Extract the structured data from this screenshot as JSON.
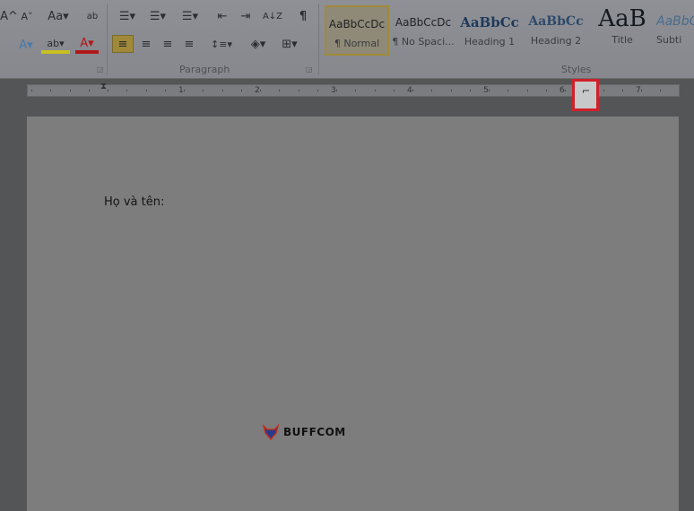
{
  "ribbon": {
    "font_buttons": [
      "A^",
      "A˅",
      "Aa▾",
      "ab"
    ],
    "font_row2": [
      "A▾",
      "ab▾",
      "A▾"
    ],
    "paragraph_row1": [
      "☰▾",
      "☰▾",
      "☰▾",
      "⇤",
      "⇥",
      "A↓Z",
      "¶"
    ],
    "paragraph_row2": [
      "≡",
      "≡",
      "≡",
      "≡",
      "↕≡▾",
      "◈▾",
      "⊞▾"
    ],
    "paragraph_label": "Paragraph",
    "styles_label": "Styles",
    "styles": [
      {
        "preview": "AaBbCcDc",
        "name": "¶ Normal",
        "selected": true
      },
      {
        "preview": "AaBbCcDc",
        "name": "¶ No Spaci..."
      },
      {
        "preview": "AaBbCc",
        "name": "Heading 1"
      },
      {
        "preview": "AaBbCc",
        "name": "Heading 2"
      },
      {
        "preview": "AaB",
        "name": "Title"
      },
      {
        "preview": "AaBbC",
        "name": "Subti"
      }
    ]
  },
  "ruler": {
    "numbers": [
      "1",
      "2",
      "3",
      "4",
      "5",
      "6",
      "7"
    ],
    "tab_selector": "⌐"
  },
  "document": {
    "text": "Họ và tên:"
  },
  "watermark": {
    "text": "BUFFCOM"
  },
  "colors": {
    "highlight_box": "#d0202a",
    "font_color_bar": "#b01818",
    "highlight_color": "#c8c020"
  }
}
